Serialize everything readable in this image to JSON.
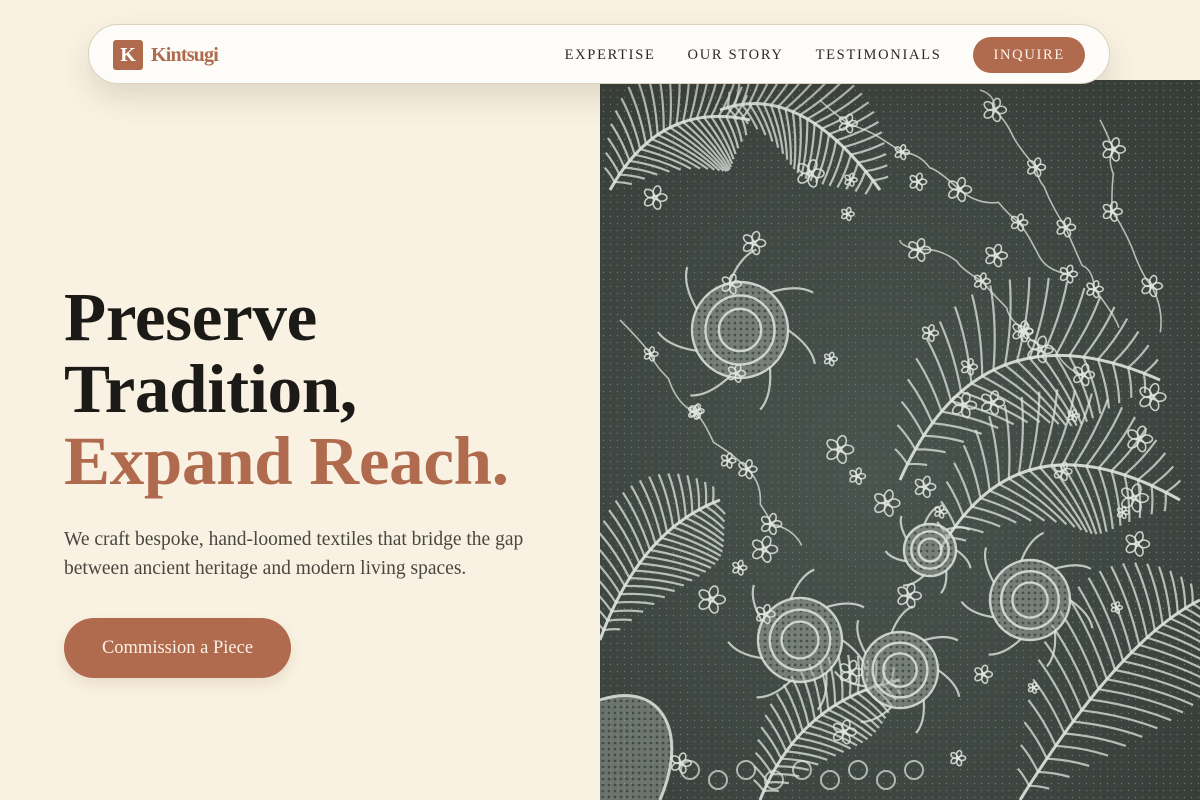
{
  "brand": {
    "mark": "K",
    "name": "Kintsugi"
  },
  "nav": {
    "links": [
      {
        "label": "EXPERTISE"
      },
      {
        "label": "OUR STORY"
      },
      {
        "label": "TESTIMONIALS"
      }
    ],
    "cta_label": "INQUIRE"
  },
  "hero": {
    "title_line_1": "Preserve",
    "title_line_2": "Tradition,",
    "title_accent": "Expand Reach.",
    "subtitle": "We craft bespoke, hand-loomed textiles that bridge the gap between ancient heritage and modern living spaces.",
    "cta_label": "Commission a Piece",
    "image_subject": "white floral lace on dark grey background"
  },
  "colors": {
    "background": "#f9f2e2",
    "accent": "#b06a4e",
    "heading": "#1b1a17",
    "body_text": "#4a4640",
    "lace_background": "#414a45",
    "lace_thread": "#dfe5df"
  }
}
